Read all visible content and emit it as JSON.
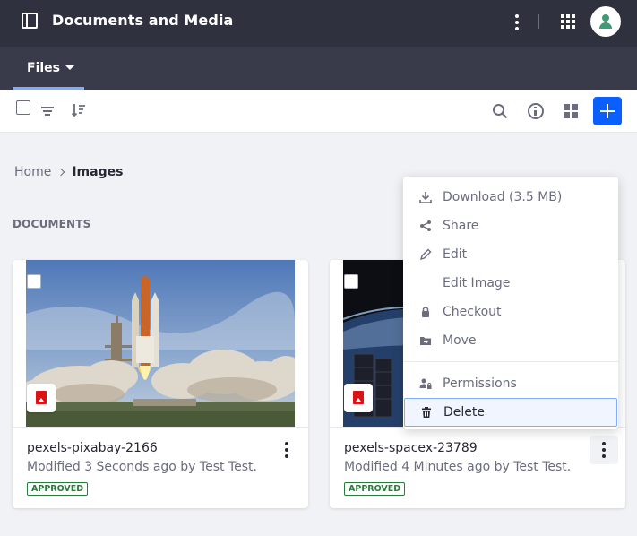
{
  "header": {
    "title": "Documents and Media",
    "icons": [
      "sidebar-toggle-icon",
      "kebab-icon",
      "apps-icon",
      "user-avatar"
    ]
  },
  "nav": {
    "tabs": [
      {
        "label": "Files",
        "icon": "caret-down-icon"
      }
    ]
  },
  "toolbar": {
    "icons": [
      "checkbox",
      "filter-icon",
      "sort-icon",
      "search-icon",
      "info-icon",
      "grid-view-icon",
      "plus-icon"
    ]
  },
  "breadcrumb": {
    "items": [
      "Home",
      "Images"
    ]
  },
  "section": {
    "title": "DOCUMENTS"
  },
  "cards": [
    {
      "title": "pexels-pixabay-2166",
      "meta": "Modified 3 Seconds ago by Test Test.",
      "status": "APPROVED"
    },
    {
      "title": "pexels-spacex-23789",
      "meta": "Modified 4 Minutes ago by Test Test.",
      "status": "APPROVED"
    }
  ],
  "menu": {
    "items": [
      {
        "label": "Download (3.5 MB)",
        "icon": "download-icon"
      },
      {
        "label": "Share",
        "icon": "share-icon"
      },
      {
        "label": "Edit",
        "icon": "pencil-icon"
      },
      {
        "label": "Edit Image",
        "icon": ""
      },
      {
        "label": "Checkout",
        "icon": "lock-icon"
      },
      {
        "label": "Move",
        "icon": "move-folder-icon"
      },
      {
        "label": "Permissions",
        "icon": "permissions-icon"
      },
      {
        "label": "Delete",
        "icon": "trash-icon"
      }
    ]
  },
  "colors": {
    "header_bg": "#30313f",
    "nav_bg": "#393a4a",
    "primary": "#0b5fff",
    "approved": "#287d3c",
    "doc_type_badge": "#da1414"
  }
}
